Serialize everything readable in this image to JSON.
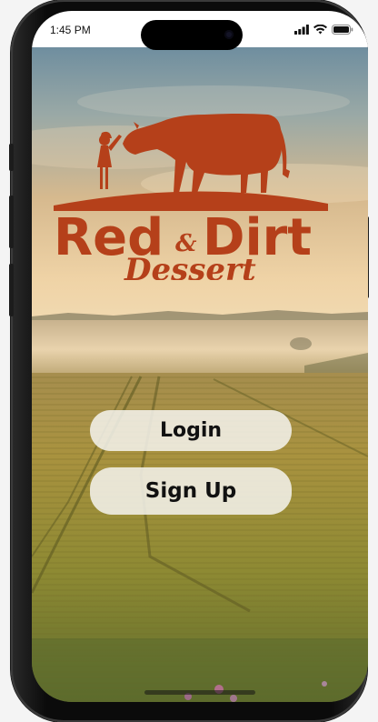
{
  "status_bar": {
    "time": "1:45 PM",
    "icons": [
      "cellular-signal-icon",
      "wifi-icon",
      "battery-icon"
    ]
  },
  "brand": {
    "logo_line1": "Red",
    "logo_ampersand": "&",
    "logo_line1_b": "Dirt",
    "logo_line2": "Dessert",
    "logo_color": "#b5401a"
  },
  "auth": {
    "login_label": "Login",
    "signup_label": "Sign Up"
  },
  "colors": {
    "button_bg": "#f5f3ee",
    "logo": "#b5401a"
  }
}
